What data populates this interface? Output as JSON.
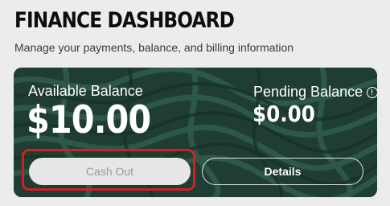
{
  "header": {
    "title": "FINANCE DASHBOARD",
    "subtitle": "Manage your payments, balance, and billing information"
  },
  "balance_card": {
    "available_label": "Available Balance",
    "available_amount": "$10.00",
    "pending_label": "Pending Balance",
    "pending_amount": "$0.00",
    "info_icon": "info-circle-icon",
    "cash_out_label": "Cash Out",
    "cash_out_state": "disabled",
    "details_label": "Details"
  },
  "colors": {
    "page_background": "#ececec",
    "card_background": "#1f3d33",
    "card_pattern": "#2e5a4c",
    "highlight": "#d21f26",
    "disabled_button_bg": "#e6e6e6",
    "disabled_button_text": "#9a9a9a"
  }
}
